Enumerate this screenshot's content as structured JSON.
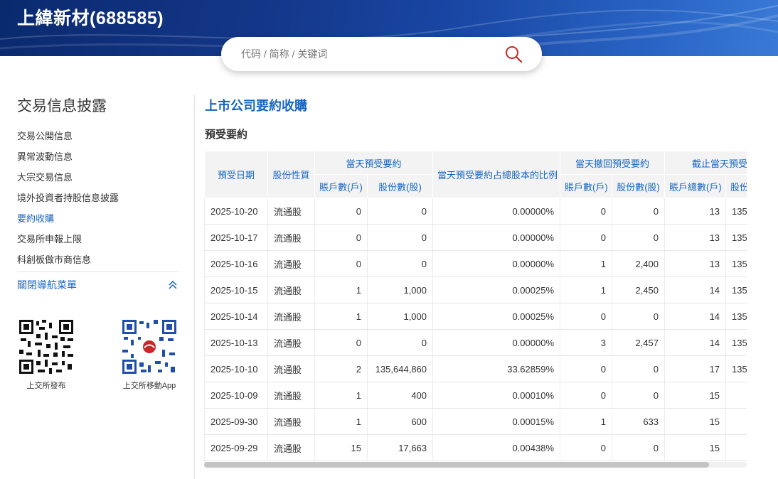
{
  "header": {
    "title": "上緯新材(688585)"
  },
  "search": {
    "placeholder": "代码 / 简称 / 关键词"
  },
  "sidebar": {
    "title": "交易信息披露",
    "items": [
      {
        "label": "交易公開信息"
      },
      {
        "label": "異常波動信息"
      },
      {
        "label": "大宗交易信息"
      },
      {
        "label": "境外投資者持股信息披露"
      },
      {
        "label": "要約收購"
      },
      {
        "label": "交易所申報上限"
      },
      {
        "label": "科創板做市商信息"
      }
    ],
    "active_index": 4,
    "toggle_label": "關閉導航菜單",
    "qr": [
      {
        "caption": "上交所發布"
      },
      {
        "caption": "上交所移動App"
      }
    ]
  },
  "main": {
    "page_title": "上市公司要約收購",
    "section_title": "預受要約",
    "table": {
      "headers": {
        "date": "預受日期",
        "share_type": "股份性質",
        "group_accept": "當天預受要約",
        "ratio": "當天預受要約占總股本的比例",
        "group_withdraw": "當天撤回預受要約",
        "group_cumulative": "截止當天預受",
        "accounts": "賬戶數(戶)",
        "shares": "股份數(股)",
        "accounts_w": "賬戶數(戶)",
        "shares_w": "股份數(股)",
        "total_accounts": "賬戶總數(戶)",
        "total_shares": "股份"
      },
      "rows": [
        {
          "date": "2025-10-20",
          "type": "流通股",
          "acc": "0",
          "shares": "0",
          "ratio": "0.00000%",
          "wacc": "0",
          "wshares": "0",
          "tacc": "13",
          "tshares": "135"
        },
        {
          "date": "2025-10-17",
          "type": "流通股",
          "acc": "0",
          "shares": "0",
          "ratio": "0.00000%",
          "wacc": "0",
          "wshares": "0",
          "tacc": "13",
          "tshares": "135"
        },
        {
          "date": "2025-10-16",
          "type": "流通股",
          "acc": "0",
          "shares": "0",
          "ratio": "0.00000%",
          "wacc": "1",
          "wshares": "2,400",
          "tacc": "13",
          "tshares": "135"
        },
        {
          "date": "2025-10-15",
          "type": "流通股",
          "acc": "1",
          "shares": "1,000",
          "ratio": "0.00025%",
          "wacc": "1",
          "wshares": "2,450",
          "tacc": "14",
          "tshares": "135"
        },
        {
          "date": "2025-10-14",
          "type": "流通股",
          "acc": "1",
          "shares": "1,000",
          "ratio": "0.00025%",
          "wacc": "0",
          "wshares": "0",
          "tacc": "14",
          "tshares": "135"
        },
        {
          "date": "2025-10-13",
          "type": "流通股",
          "acc": "0",
          "shares": "0",
          "ratio": "0.00000%",
          "wacc": "3",
          "wshares": "2,457",
          "tacc": "14",
          "tshares": "135"
        },
        {
          "date": "2025-10-10",
          "type": "流通股",
          "acc": "2",
          "shares": "135,644,860",
          "ratio": "33.62859%",
          "wacc": "0",
          "wshares": "0",
          "tacc": "17",
          "tshares": "135"
        },
        {
          "date": "2025-10-09",
          "type": "流通股",
          "acc": "1",
          "shares": "400",
          "ratio": "0.00010%",
          "wacc": "0",
          "wshares": "0",
          "tacc": "15",
          "tshares": ""
        },
        {
          "date": "2025-09-30",
          "type": "流通股",
          "acc": "1",
          "shares": "600",
          "ratio": "0.00015%",
          "wacc": "1",
          "wshares": "633",
          "tacc": "15",
          "tshares": ""
        },
        {
          "date": "2025-09-29",
          "type": "流通股",
          "acc": "15",
          "shares": "17,663",
          "ratio": "0.00438%",
          "wacc": "0",
          "wshares": "0",
          "tacc": "15",
          "tshares": ""
        }
      ]
    },
    "scroll_position": 0.93
  }
}
